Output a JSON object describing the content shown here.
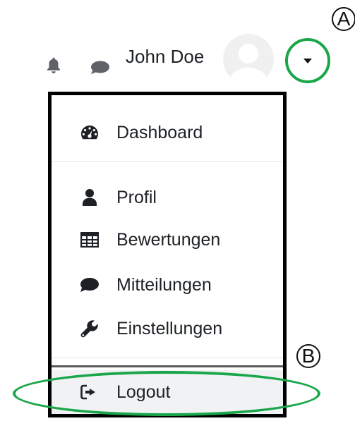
{
  "navbar": {
    "notifications_icon": "bell-icon",
    "messages_icon": "chat-bubble-icon",
    "user_name": "John Doe",
    "avatar_icon": "user-avatar-placeholder",
    "menu_toggle_icon": "caret-down-icon"
  },
  "callouts": {
    "a": "A",
    "b": "B"
  },
  "user_menu": {
    "items": [
      {
        "label": "Dashboard",
        "icon": "dashboard-gauge-icon"
      },
      {
        "label": "Profil",
        "icon": "user-icon"
      },
      {
        "label": "Bewertungen",
        "icon": "table-grid-icon"
      },
      {
        "label": "Mitteilungen",
        "icon": "chat-bubble-icon"
      },
      {
        "label": "Einstellungen",
        "icon": "wrench-icon"
      },
      {
        "label": "Logout",
        "icon": "sign-out-icon"
      }
    ]
  },
  "colors": {
    "highlight_green": "#1aa64a",
    "text": "#1d2125",
    "avatar_grey": "#f0f0f0",
    "hover_bg": "#f1f2f4"
  }
}
